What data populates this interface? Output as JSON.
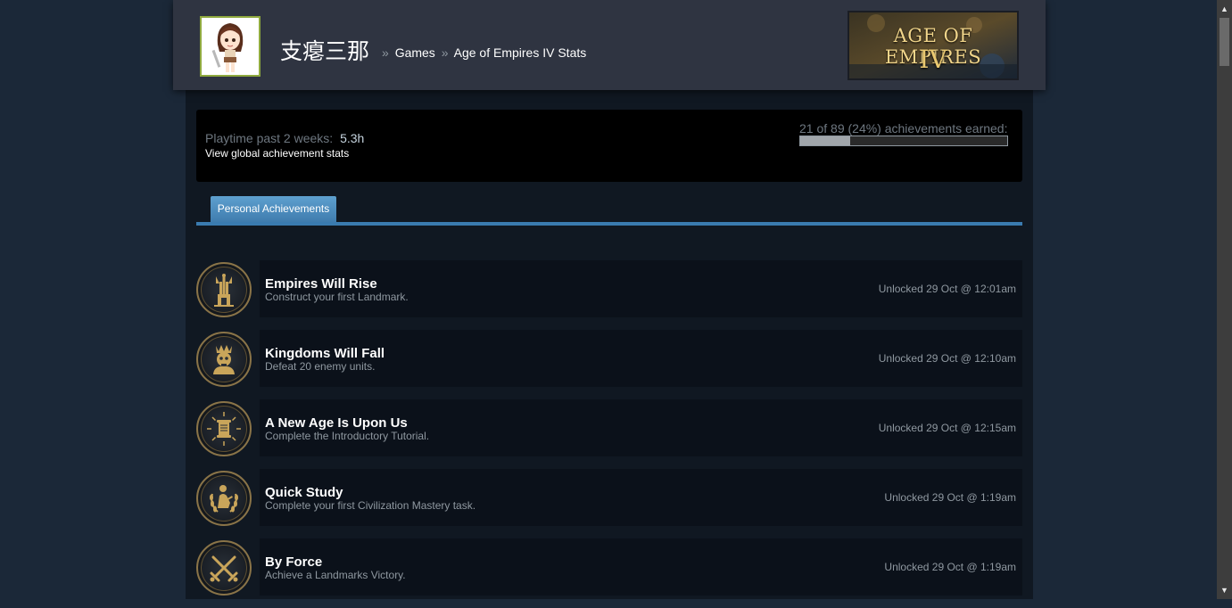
{
  "header": {
    "persona_name": "支瘪三那",
    "breadcrumb_sep": "»",
    "breadcrumb_games": "Games",
    "breadcrumb_current": "Age of Empires IV Stats",
    "game_logo_line1": "AGE OF EMPIRES",
    "game_logo_line2": "IV"
  },
  "summary": {
    "playtime_label": "Playtime past 2 weeks:",
    "playtime_value": "5.3h",
    "global_stats_link": "View global achievement stats",
    "achievements_earned_text": "21 of 89 (24%) achievements earned:",
    "progress_fraction": 0.24
  },
  "tabs": [
    {
      "label": "Personal Achievements",
      "active": true
    }
  ],
  "achievements": [
    {
      "title": "Empires Will Rise",
      "description": "Construct your first Landmark.",
      "unlocked": "Unlocked 29 Oct @ 12:01am",
      "icon": "landmark-tower-icon"
    },
    {
      "title": "Kingdoms Will Fall",
      "description": "Defeat 20 enemy units.",
      "unlocked": "Unlocked 29 Oct @ 12:10am",
      "icon": "crowned-skull-icon"
    },
    {
      "title": "A New Age Is Upon Us",
      "description": "Complete the Introductory Tutorial.",
      "unlocked": "Unlocked 29 Oct @ 12:15am",
      "icon": "scroll-sunburst-icon"
    },
    {
      "title": "Quick Study",
      "description": "Complete your first Civilization Mastery task.",
      "unlocked": "Unlocked 29 Oct @ 1:19am",
      "icon": "scholar-laurel-icon"
    },
    {
      "title": "By Force",
      "description": "Achieve a Landmarks Victory.",
      "unlocked": "Unlocked 29 Oct @ 1:19am",
      "icon": "crossed-swords-icon"
    }
  ],
  "colors": {
    "page_bg": "#1b2838",
    "header_bg": "#2f3441",
    "accent_blue": "#3a7bb0",
    "avatar_border": "#8fa93e",
    "icon_gold": "#c9a55a"
  },
  "scrollbar": {
    "up_arrow": "▲",
    "down_arrow": "▼"
  }
}
